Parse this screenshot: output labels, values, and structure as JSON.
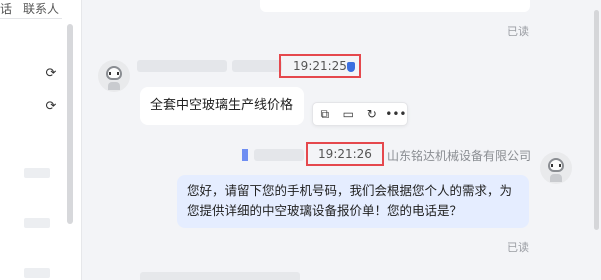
{
  "sidebar": {
    "tabs": [
      "话",
      "联系人"
    ]
  },
  "messages": {
    "read_label": "已读",
    "incoming": {
      "time": "19:21:25",
      "text": "全套中空玻璃生产线价格"
    },
    "outgoing": {
      "time": "19:21:26",
      "sender": "山东铭达机械设备有限公司",
      "line1": "您好，请留下您的手机号码，我们会根据您个人的需求，为",
      "line2": "您提供详细的中空玻璃设备报价单！您的电话是？"
    }
  },
  "toolbar_icons": [
    "copy-icon",
    "quote-icon",
    "reply-icon",
    "more-icon"
  ],
  "colors": {
    "highlight_border": "#e5484d",
    "outgoing_bubble": "#e5edff",
    "incoming_bubble": "#ffffff"
  }
}
